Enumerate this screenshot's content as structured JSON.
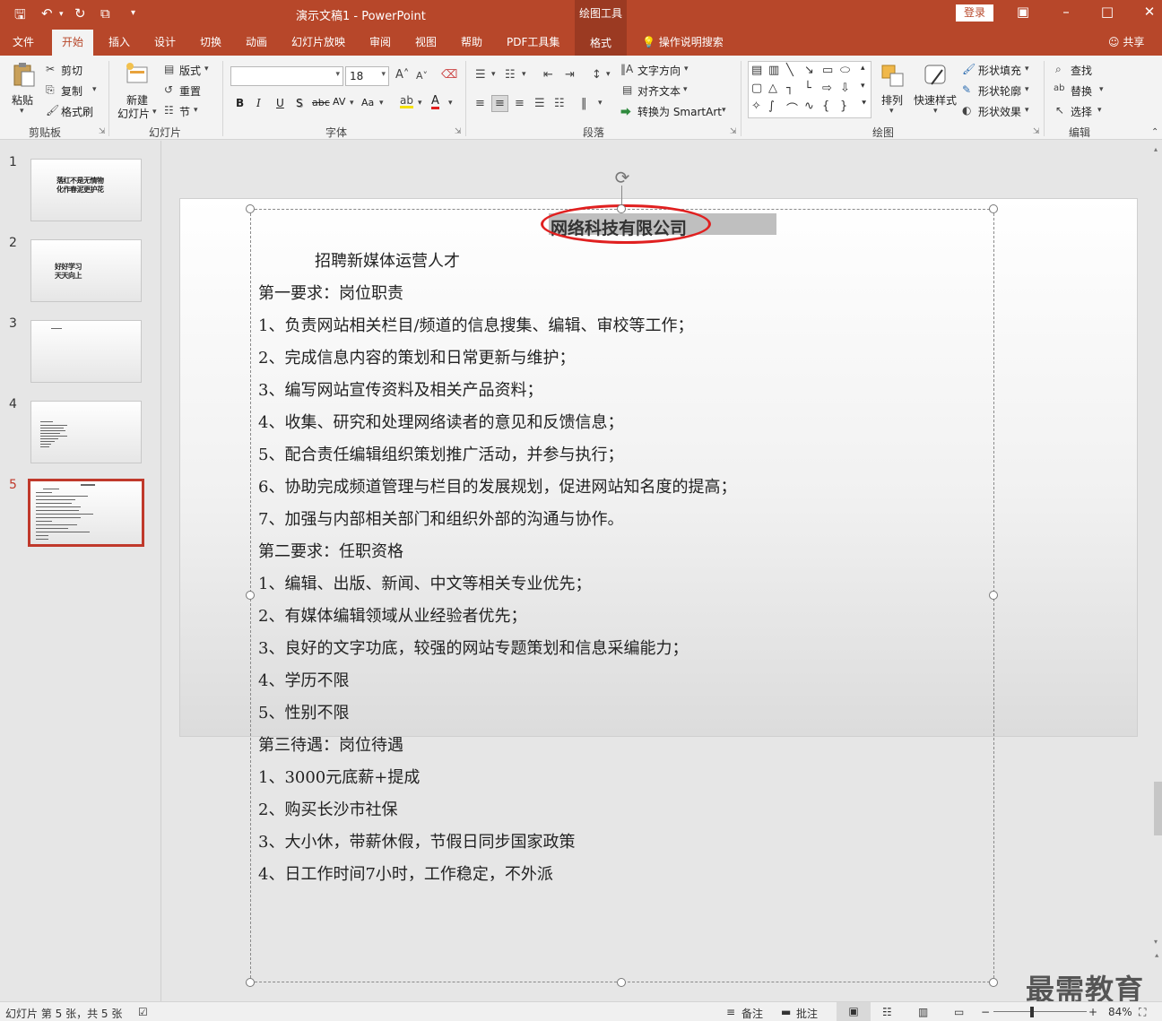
{
  "titlebar": {
    "doc_title": "演示文稿1  -  PowerPoint",
    "context_tool": "绘图工具",
    "login": "登录"
  },
  "tabs": {
    "file": "文件",
    "home": "开始",
    "insert": "插入",
    "design": "设计",
    "transitions": "切换",
    "animations": "动画",
    "slideshow": "幻灯片放映",
    "review": "审阅",
    "view": "视图",
    "help": "帮助",
    "pdf": "PDF工具集",
    "format": "格式",
    "tellme": "操作说明搜索",
    "share": "共享"
  },
  "ribbon": {
    "clipboard": {
      "paste": "粘贴",
      "cut": "剪切",
      "copy": "复制",
      "format_painter": "格式刷",
      "label": "剪贴板"
    },
    "slides": {
      "new_slide_1": "新建",
      "new_slide_2": "幻灯片",
      "layout": "版式",
      "reset": "重置",
      "section": "节",
      "label": "幻灯片"
    },
    "font": {
      "font_name": "",
      "font_size": "18",
      "bold": "B",
      "italic": "I",
      "underline": "U",
      "shadow": "S",
      "strike": "abc",
      "spacing": "AV",
      "case": "Aa",
      "label": "字体"
    },
    "paragraph": {
      "text_direction": "文字方向",
      "align_text": "对齐文本",
      "smartart": "转换为 SmartArt",
      "label": "段落"
    },
    "drawing": {
      "arrange": "排列",
      "quick_styles": "快速样式",
      "shape_fill": "形状填充",
      "shape_outline": "形状轮廓",
      "shape_effects": "形状效果",
      "label": "绘图"
    },
    "editing": {
      "find": "查找",
      "replace": "替换",
      "select": "选择",
      "label": "编辑"
    }
  },
  "thumbnails": [
    {
      "num": "1",
      "lines": [
        "落红不是无情物",
        "化作春泥更护花"
      ]
    },
    {
      "num": "2",
      "lines": [
        "好好学习",
        "天天向上"
      ]
    },
    {
      "num": "3",
      "lines": []
    },
    {
      "num": "4",
      "lines": []
    },
    {
      "num": "5",
      "lines": []
    }
  ],
  "slide": {
    "company": "网络科技有限公司",
    "lines": [
      "招聘新媒体运营人才",
      "第一要求：岗位职责",
      "1、负责网站相关栏目/频道的信息搜集、编辑、审校等工作；",
      "2、完成信息内容的策划和日常更新与维护；",
      "3、编写网站宣传资料及相关产品资料；",
      "4、收集、研究和处理网络读者的意见和反馈信息；",
      "5、配合责任编辑组织策划推广活动，并参与执行；",
      "6、协助完成频道管理与栏目的发展规划，促进网站知名度的提高；",
      "7、加强与内部相关部门和组织外部的沟通与协作。",
      "第二要求：任职资格",
      "1、编辑、出版、新闻、中文等相关专业优先；",
      "2、有媒体编辑领域从业经验者优先；",
      "3、良好的文字功底，较强的网站专题策划和信息采编能力；",
      "4、学历不限",
      "5、性别不限",
      "第三待遇：岗位待遇",
      "1、3000元底薪+提成",
      "2、购买长沙市社保",
      "3、大小休，带薪休假，节假日同步国家政策",
      "4、日工作时间7小时，工作稳定，不外派"
    ]
  },
  "watermark": "最需教育",
  "statusbar": {
    "slide_info": "幻灯片 第 5 张，共 5 张",
    "notes": "备注",
    "comments": "批注",
    "zoom": "84%"
  }
}
